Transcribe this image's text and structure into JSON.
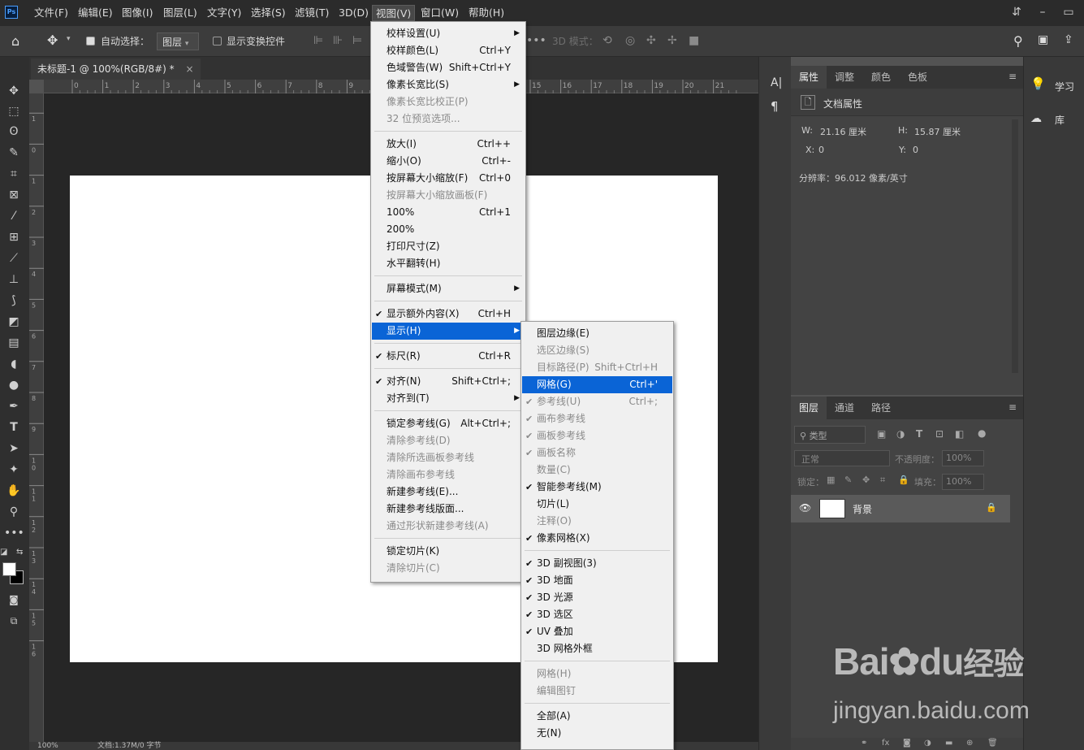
{
  "app": {
    "logo": "Ps"
  },
  "menubar": {
    "items": [
      "文件(F)",
      "编辑(E)",
      "图像(I)",
      "图层(L)",
      "文字(Y)",
      "选择(S)",
      "滤镜(T)",
      "3D(D)",
      "视图(V)",
      "窗口(W)",
      "帮助(H)"
    ]
  },
  "options": {
    "auto_select_label": "自动选择：",
    "layer_dropdown": "图层",
    "show_transform_label": "显示变换控件",
    "mode_3d_label": "3D 模式："
  },
  "document": {
    "tab_title": "未标题-1 @ 100%(RGB/8#) *",
    "zoom": "100%",
    "status": "文档:1.37M/0 字节"
  },
  "ruler": {
    "h": [
      "0",
      "1",
      "2",
      "3",
      "4",
      "5",
      "6",
      "7",
      "8",
      "9",
      "10",
      "11",
      "12",
      "13",
      "14",
      "15",
      "16",
      "17",
      "18",
      "19",
      "20",
      "21"
    ],
    "v": [
      "2",
      "1",
      "0",
      "1",
      "2",
      "3",
      "4",
      "5",
      "6",
      "7",
      "8",
      "9",
      "1 0",
      "1 1",
      "1 2",
      "1 3",
      "1 4",
      "1 5",
      "1 6"
    ]
  },
  "view_menu": {
    "rows": [
      {
        "label": "校样设置(U)",
        "shortcut": "",
        "arrow": true
      },
      {
        "label": "校样颜色(L)",
        "shortcut": "Ctrl+Y"
      },
      {
        "label": "色域警告(W)",
        "shortcut": "Shift+Ctrl+Y"
      },
      {
        "label": "像素长宽比(S)",
        "shortcut": "",
        "arrow": true
      },
      {
        "label": "像素长宽比校正(P)",
        "shortcut": "",
        "disabled": true
      },
      {
        "label": "32 位预览选项...",
        "shortcut": "",
        "disabled": true
      },
      {
        "sep": true
      },
      {
        "label": "放大(I)",
        "shortcut": "Ctrl++"
      },
      {
        "label": "缩小(O)",
        "shortcut": "Ctrl+-"
      },
      {
        "label": "按屏幕大小缩放(F)",
        "shortcut": "Ctrl+0"
      },
      {
        "label": "按屏幕大小缩放画板(F)",
        "shortcut": "",
        "disabled": true
      },
      {
        "label": "100%",
        "shortcut": "Ctrl+1"
      },
      {
        "label": "200%",
        "shortcut": ""
      },
      {
        "label": "打印尺寸(Z)",
        "shortcut": ""
      },
      {
        "label": "水平翻转(H)",
        "shortcut": ""
      },
      {
        "sep": true
      },
      {
        "label": "屏幕模式(M)",
        "shortcut": "",
        "arrow": true
      },
      {
        "sep": true
      },
      {
        "label": "显示额外内容(X)",
        "shortcut": "Ctrl+H",
        "checked": true
      },
      {
        "label": "显示(H)",
        "shortcut": "",
        "arrow": true,
        "highlight": true
      },
      {
        "sep": true
      },
      {
        "label": "标尺(R)",
        "shortcut": "Ctrl+R",
        "checked": true
      },
      {
        "sep": true
      },
      {
        "label": "对齐(N)",
        "shortcut": "Shift+Ctrl+;",
        "checked": true
      },
      {
        "label": "对齐到(T)",
        "shortcut": "",
        "arrow": true
      },
      {
        "sep": true
      },
      {
        "label": "锁定参考线(G)",
        "shortcut": "Alt+Ctrl+;"
      },
      {
        "label": "清除参考线(D)",
        "shortcut": "",
        "disabled": true
      },
      {
        "label": "清除所选画板参考线",
        "shortcut": "",
        "disabled": true
      },
      {
        "label": "清除画布参考线",
        "shortcut": "",
        "disabled": true
      },
      {
        "label": "新建参考线(E)...",
        "shortcut": ""
      },
      {
        "label": "新建参考线版面...",
        "shortcut": ""
      },
      {
        "label": "通过形状新建参考线(A)",
        "shortcut": "",
        "disabled": true
      },
      {
        "sep": true
      },
      {
        "label": "锁定切片(K)",
        "shortcut": ""
      },
      {
        "label": "清除切片(C)",
        "shortcut": "",
        "disabled": true
      }
    ]
  },
  "show_submenu": {
    "rows": [
      {
        "label": "图层边缘(E)",
        "shortcut": ""
      },
      {
        "label": "选区边缘(S)",
        "shortcut": "",
        "disabled": true
      },
      {
        "label": "目标路径(P)",
        "shortcut": "Shift+Ctrl+H",
        "disabled": true
      },
      {
        "label": "网格(G)",
        "shortcut": "Ctrl+'",
        "highlight": true
      },
      {
        "label": "参考线(U)",
        "shortcut": "Ctrl+;",
        "checked": true,
        "disabled": true
      },
      {
        "label": "画布参考线",
        "shortcut": "",
        "checked": true,
        "disabled": true
      },
      {
        "label": "画板参考线",
        "shortcut": "",
        "checked": true,
        "disabled": true
      },
      {
        "label": "画板名称",
        "shortcut": "",
        "checked": true,
        "disabled": true
      },
      {
        "label": "数量(C)",
        "shortcut": "",
        "disabled": true
      },
      {
        "label": "智能参考线(M)",
        "shortcut": "",
        "checked": true
      },
      {
        "label": "切片(L)",
        "shortcut": ""
      },
      {
        "label": "注释(O)",
        "shortcut": "",
        "disabled": true
      },
      {
        "label": "像素网格(X)",
        "shortcut": "",
        "checked": true
      },
      {
        "sep": true
      },
      {
        "label": "3D 副视图(3)",
        "shortcut": "",
        "checked": true
      },
      {
        "label": "3D 地面",
        "shortcut": "",
        "checked": true
      },
      {
        "label": "3D 光源",
        "shortcut": "",
        "checked": true
      },
      {
        "label": "3D 选区",
        "shortcut": "",
        "checked": true
      },
      {
        "label": "UV 叠加",
        "shortcut": "",
        "checked": true
      },
      {
        "label": "3D 网格外框",
        "shortcut": ""
      },
      {
        "sep": true
      },
      {
        "label": "网格(H)",
        "shortcut": "",
        "disabled": true
      },
      {
        "label": "编辑图钉",
        "shortcut": "",
        "disabled": true
      },
      {
        "sep": true
      },
      {
        "label": "全部(A)",
        "shortcut": ""
      },
      {
        "label": "无(N)",
        "shortcut": ""
      }
    ]
  },
  "properties": {
    "tabs": [
      "属性",
      "调整",
      "颜色",
      "色板"
    ],
    "doc_props": "文档属性",
    "w_label": "W:",
    "w_value": "21.16 厘米",
    "h_label": "H:",
    "h_value": "15.87 厘米",
    "x_label": "X:",
    "x_value": "0",
    "y_label": "Y:",
    "y_value": "0",
    "resolution": "分辨率：96.012 像素/英寸"
  },
  "layers": {
    "tabs": [
      "图层",
      "通道",
      "路径"
    ],
    "filter_label": "类型",
    "blend_mode": "正常",
    "opacity_label": "不透明度：",
    "opacity_value": "100%",
    "lock_label": "锁定：",
    "fill_label": "填充：",
    "fill_value": "100%",
    "layer_name": "背景"
  },
  "right_panel": {
    "learn": "学习",
    "library": "库"
  },
  "watermark": {
    "brand": "Bai",
    "brand2": "du",
    "cn": "经验",
    "url": "jingyan.baidu.com"
  }
}
